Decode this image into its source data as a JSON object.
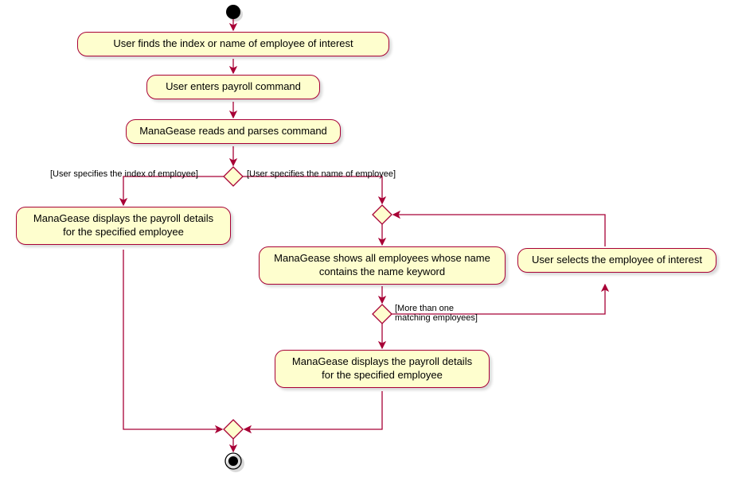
{
  "nodes": {
    "n1": "User finds the index or name of employee of interest",
    "n2": "User enters payroll command",
    "n3": "ManaGease reads and parses command",
    "n4": "ManaGease displays the payroll\ndetails for the specified employee",
    "n5": "ManaGease shows all employees\nwhose name contains the name keyword",
    "n6": "User selects the employee of interest",
    "n7": "ManaGease displays the payroll\ndetails for the specified employee"
  },
  "labels": {
    "l_left": "[User specifies the index of employee]",
    "l_right": "[User specifies the name of employee]",
    "l_more": "[More than one\nmatching employees]"
  },
  "chart_data": {
    "type": "uml-activity",
    "title": "",
    "start": "start",
    "end": "end",
    "activities": [
      {
        "id": "n1",
        "text": "User finds the index or name of employee of interest"
      },
      {
        "id": "n2",
        "text": "User enters payroll command"
      },
      {
        "id": "n3",
        "text": "ManaGease reads and parses command"
      },
      {
        "id": "n4",
        "text": "ManaGease displays the payroll details for the specified employee"
      },
      {
        "id": "n5",
        "text": "ManaGease shows all employees whose name contains the name keyword"
      },
      {
        "id": "n6",
        "text": "User selects the employee of interest"
      },
      {
        "id": "n7",
        "text": "ManaGease displays the payroll details for the specified employee"
      }
    ],
    "decisions": [
      {
        "id": "d1",
        "branches": [
          {
            "guard": "User specifies the index of employee",
            "to": "n4"
          },
          {
            "guard": "User specifies the name of employee",
            "to": "d2"
          }
        ]
      },
      {
        "id": "d2",
        "type": "merge",
        "to": "n5"
      },
      {
        "id": "d3",
        "branches": [
          {
            "guard": "More than one matching employees",
            "to": "n6"
          },
          {
            "guard": "",
            "to": "n7"
          }
        ]
      },
      {
        "id": "d4",
        "type": "merge",
        "to": "end"
      }
    ],
    "edges": [
      {
        "from": "start",
        "to": "n1"
      },
      {
        "from": "n1",
        "to": "n2"
      },
      {
        "from": "n2",
        "to": "n3"
      },
      {
        "from": "n3",
        "to": "d1"
      },
      {
        "from": "n4",
        "to": "d4"
      },
      {
        "from": "n5",
        "to": "d3"
      },
      {
        "from": "n6",
        "to": "d2"
      },
      {
        "from": "n7",
        "to": "d4"
      },
      {
        "from": "d4",
        "to": "end"
      }
    ]
  }
}
